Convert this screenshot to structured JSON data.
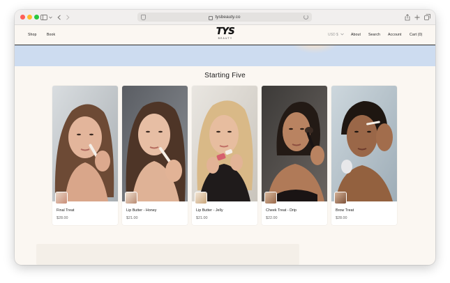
{
  "browser": {
    "url": "tysbeauty.co",
    "icons": [
      "sidebar-icon",
      "chevron-down-icon",
      "back-icon",
      "forward-icon",
      "shield-icon",
      "lock-icon",
      "reload-icon",
      "share-icon",
      "new-tab-icon",
      "tabs-icon"
    ]
  },
  "header": {
    "nav_left": [
      "Shop",
      "Book"
    ],
    "logo_main": "TYS",
    "logo_sub": "BEAUTY",
    "currency": "USD $",
    "nav_right": [
      "About",
      "Search",
      "Account",
      "Cart (0)"
    ]
  },
  "section": {
    "title": "Starting Five"
  },
  "products": [
    {
      "name": "Final Treat",
      "price": "$28.00",
      "accent": "#c98e78"
    },
    {
      "name": "Lip Butter - Honey",
      "price": "$21.00",
      "accent": "#b98c74"
    },
    {
      "name": "Lip Butter - Jelly",
      "price": "$21.00",
      "accent": "#c9a67c"
    },
    {
      "name": "Cheek Treat - Drip",
      "price": "$22.00",
      "accent": "#9a6a4c"
    },
    {
      "name": "Brow Treat",
      "price": "$28.00",
      "accent": "#7e523a"
    }
  ],
  "colors": {
    "page_bg": "#fbf7f2",
    "banner": "#cddcf0",
    "text": "#1a1a1a"
  }
}
